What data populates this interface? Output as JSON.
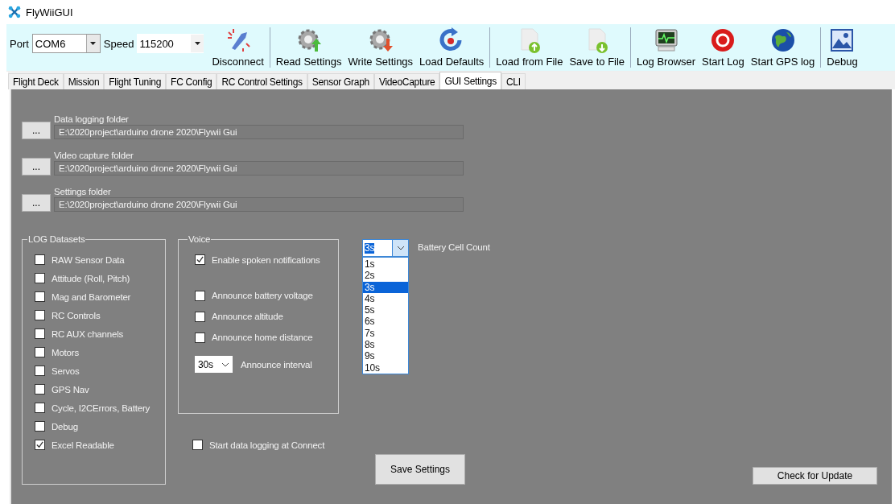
{
  "window": {
    "title": "FlyWiiGUI"
  },
  "toolbar": {
    "port": {
      "label": "Port",
      "value": "COM6"
    },
    "speed": {
      "label": "Speed",
      "value": "115200"
    },
    "groups": [
      [
        {
          "label": "Disconnect",
          "kind": "disconnect"
        }
      ],
      [
        {
          "label": "Read Settings",
          "kind": "gear-up"
        },
        {
          "label": "Write Settings",
          "kind": "gear-down"
        },
        {
          "label": "Load Defaults",
          "kind": "reload"
        }
      ],
      [
        {
          "label": "Load from File",
          "kind": "file-up"
        },
        {
          "label": "Save to File",
          "kind": "file-down"
        }
      ],
      [
        {
          "label": "Log Browser",
          "kind": "monitor"
        },
        {
          "label": "Start Log",
          "kind": "record"
        },
        {
          "label": "Start GPS log",
          "kind": "globe"
        }
      ],
      [
        {
          "label": "Debug",
          "kind": "image"
        }
      ]
    ]
  },
  "tabs": [
    {
      "label": "Flight Deck",
      "selected": false
    },
    {
      "label": "Mission",
      "selected": false
    },
    {
      "label": "Flight Tuning",
      "selected": false
    },
    {
      "label": "FC Config",
      "selected": false
    },
    {
      "label": "RC Control Settings",
      "selected": false
    },
    {
      "label": "Sensor Graph",
      "selected": false
    },
    {
      "label": "VideoCapture",
      "selected": false
    },
    {
      "label": "GUI Settings",
      "selected": true
    },
    {
      "label": "CLI",
      "selected": false
    }
  ],
  "folders": [
    {
      "label": "Data logging folder",
      "button": "...",
      "value": "E:\\2020project\\arduino drone 2020\\Flywii Gui"
    },
    {
      "label": "Video capture folder",
      "button": "...",
      "value": "E:\\2020project\\arduino drone 2020\\Flywii Gui"
    },
    {
      "label": "Settings folder",
      "button": "...",
      "value": "E:\\2020project\\arduino drone 2020\\Flywii Gui"
    }
  ],
  "log_datasets": {
    "title": "LOG Datasets",
    "items": [
      {
        "label": "RAW Sensor Data",
        "checked": false
      },
      {
        "label": "Attitude (Roll, Pitch)",
        "checked": false
      },
      {
        "label": "Mag and Barometer",
        "checked": false
      },
      {
        "label": "RC Controls",
        "checked": false
      },
      {
        "label": "RC AUX channels",
        "checked": false
      },
      {
        "label": "Motors",
        "checked": false
      },
      {
        "label": "Servos",
        "checked": false
      },
      {
        "label": "GPS Nav",
        "checked": false
      },
      {
        "label": "Cycle, I2CErrors, Battery",
        "checked": false
      },
      {
        "label": "Debug",
        "checked": false
      },
      {
        "label": "Excel Readable",
        "checked": true
      }
    ]
  },
  "voice": {
    "title": "Voice",
    "items": [
      {
        "label": "Enable spoken notifications",
        "checked": true
      },
      {
        "label": "Announce battery voltage",
        "checked": false
      },
      {
        "label": "Announce altitude",
        "checked": false
      },
      {
        "label": "Announce home distance",
        "checked": false
      }
    ],
    "interval": {
      "value": "30s",
      "label": "Announce interval"
    }
  },
  "start_logging": {
    "label": "Start data logging at Connect",
    "checked": false
  },
  "battery": {
    "value": "3s",
    "label": "Battery Cell Count",
    "options": [
      {
        "label": "1s",
        "selected": false
      },
      {
        "label": "2s",
        "selected": false
      },
      {
        "label": "3s",
        "selected": true
      },
      {
        "label": "4s",
        "selected": false
      },
      {
        "label": "5s",
        "selected": false
      },
      {
        "label": "6s",
        "selected": false
      },
      {
        "label": "7s",
        "selected": false
      },
      {
        "label": "8s",
        "selected": false
      },
      {
        "label": "9s",
        "selected": false
      },
      {
        "label": "10s",
        "selected": false
      }
    ]
  },
  "save_button": "Save Settings",
  "update_button": "Check for Update"
}
